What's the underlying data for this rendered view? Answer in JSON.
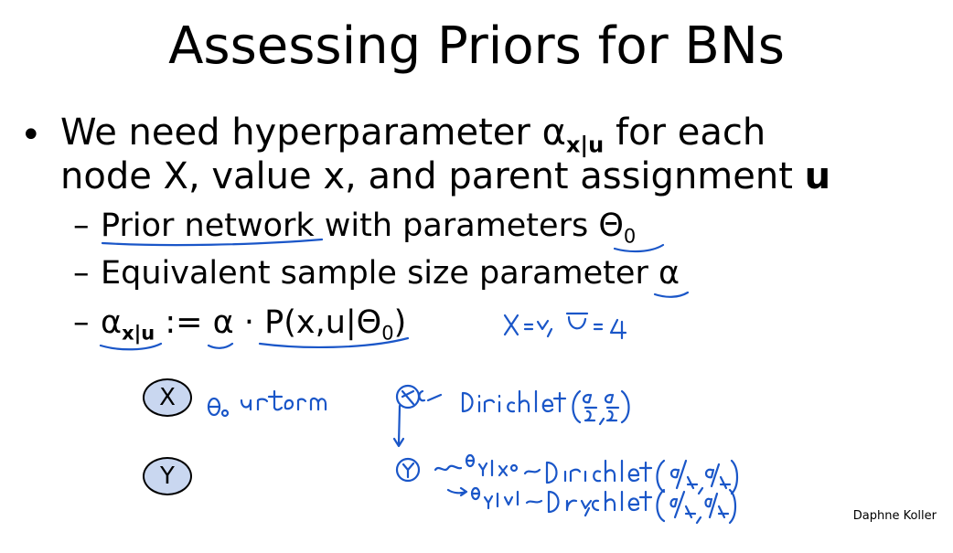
{
  "slide": {
    "title": "Assessing Priors for BNs",
    "bullet": {
      "marker": "•",
      "line1_text": "We need hyperparameter ",
      "alpha": "α",
      "alpha_sub": "x|u",
      "line1_end": " for each",
      "line2_text": "node X, value x, and parent assignment ",
      "line2_bold": "u"
    },
    "subbullets": [
      {
        "dash": "–",
        "text_a": "Prior network",
        "text_b": " with parameters ",
        "symbol": "Θ",
        "symbol_sub": "0"
      },
      {
        "dash": "–",
        "text_a": "Equivalent sample size parameter ",
        "symbol": "α"
      },
      {
        "dash": "–",
        "alpha": "α",
        "alpha_sub": "x|u",
        "assign": " := ",
        "alpha2": "α",
        "dot": " · ",
        "p_open": "P(x,u|Θ",
        "p_sub": "0",
        "p_close": ")"
      }
    ],
    "nodes": [
      {
        "label": "X"
      },
      {
        "label": "Y"
      }
    ],
    "footer": "Daphne Koller"
  },
  "annotations": {
    "ink_color": "#1a56c8",
    "handwriting": [
      "X = v, U = 4",
      "Θ₀ uniform",
      "Dirichlet ( α/2, α/2 )",
      "Θ Y|x⁰ ~ Dirichlet ( α/4, α/4 )",
      "Θ Y|x¹ ~ Dirichlet ( α/4, α/4 )"
    ]
  }
}
